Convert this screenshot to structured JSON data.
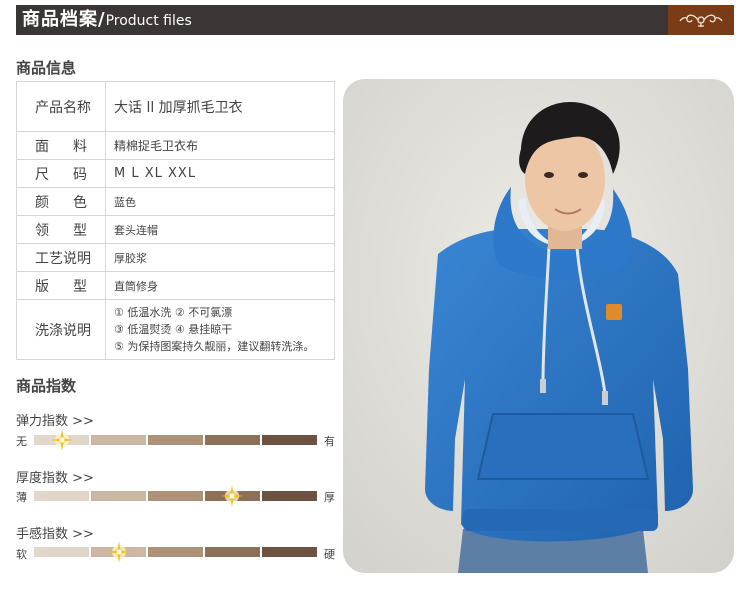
{
  "header": {
    "title_cn": "商品档案/",
    "title_en": "Product files"
  },
  "info_heading": "商品信息",
  "spec_rows": [
    {
      "key": "产品名称",
      "value": "大话 ll 加厚抓毛卫衣"
    },
    {
      "key": "面料",
      "value": "精棉捉毛卫衣布"
    },
    {
      "key": "尺码",
      "value": "M L XL XXL"
    },
    {
      "key": "颜色",
      "value": "蓝色"
    },
    {
      "key": "领型",
      "value": "套头连帽"
    },
    {
      "key": "工艺说明",
      "value": "厚胶浆"
    },
    {
      "key": "版型",
      "value": "直筒修身"
    }
  ],
  "wash": {
    "key": "洗涤说明",
    "lines": [
      "① 低温水洗 ② 不可氯漂",
      "③ 低温熨烫 ④ 悬挂晾干",
      "⑤ 为保持图案持久靓丽，建议翻转洗涤。"
    ]
  },
  "index_heading": "商品指数",
  "meters": [
    {
      "label": "弹力指数 >>",
      "min": "无",
      "max": "有",
      "level_fraction": 0.1
    },
    {
      "label": "厚度指数 >>",
      "min": "薄",
      "max": "厚",
      "level_fraction": 0.7
    },
    {
      "label": "手感指数 >>",
      "min": "软",
      "max": "硬",
      "level_fraction": 0.3
    }
  ],
  "colors": {
    "header_bg": "#3b3635",
    "header_accent": "#7a3b17",
    "meter_segments": [
      "#e3d7cb",
      "#cbb7a4",
      "#ad9277",
      "#8d7058",
      "#6d5241"
    ],
    "hoodie_blue": "#2a74c4"
  },
  "icons": {
    "header_ornament": "scroll-ornament-icon",
    "meter_marker": "sparkle-star-icon"
  }
}
